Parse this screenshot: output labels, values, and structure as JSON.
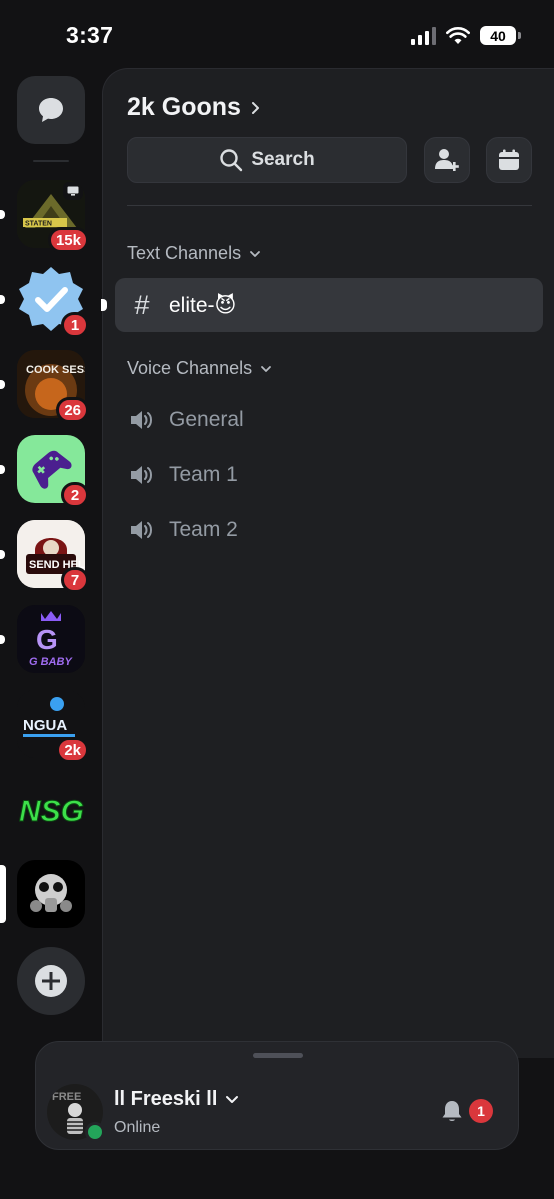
{
  "status_bar": {
    "time": "3:37",
    "battery": "40"
  },
  "server_rail": {
    "servers": [
      {
        "badge": "15k",
        "logo_text": "STATEN"
      },
      {
        "badge": "1"
      },
      {
        "badge": "26",
        "logo_text": "COOK SESSION"
      },
      {
        "badge": "2"
      },
      {
        "badge": "7",
        "logo_text": "SEND HELP"
      },
      {
        "badge": "",
        "logo_text": "G BABY"
      },
      {
        "badge": "2k",
        "logo_text": "NGUA"
      },
      {
        "badge": "",
        "logo_text": "NSG"
      },
      {
        "badge": ""
      }
    ]
  },
  "guild": {
    "name": "2k Goons",
    "search_label": "Search",
    "text_category": "Text Channels",
    "voice_category": "Voice Channels",
    "text_channels": [
      {
        "name": "elite-😈"
      }
    ],
    "voice_channels": [
      {
        "name": "General"
      },
      {
        "name": "Team 1"
      },
      {
        "name": "Team 2"
      }
    ]
  },
  "user": {
    "name": "ll Freeski ll",
    "status": "Online",
    "avatar_text": "FREE",
    "notification_count": "1"
  },
  "colors": {
    "accent_badge": "#da373c",
    "online": "#23a55a",
    "panel": "#1e1f22",
    "rail": "#121214"
  }
}
